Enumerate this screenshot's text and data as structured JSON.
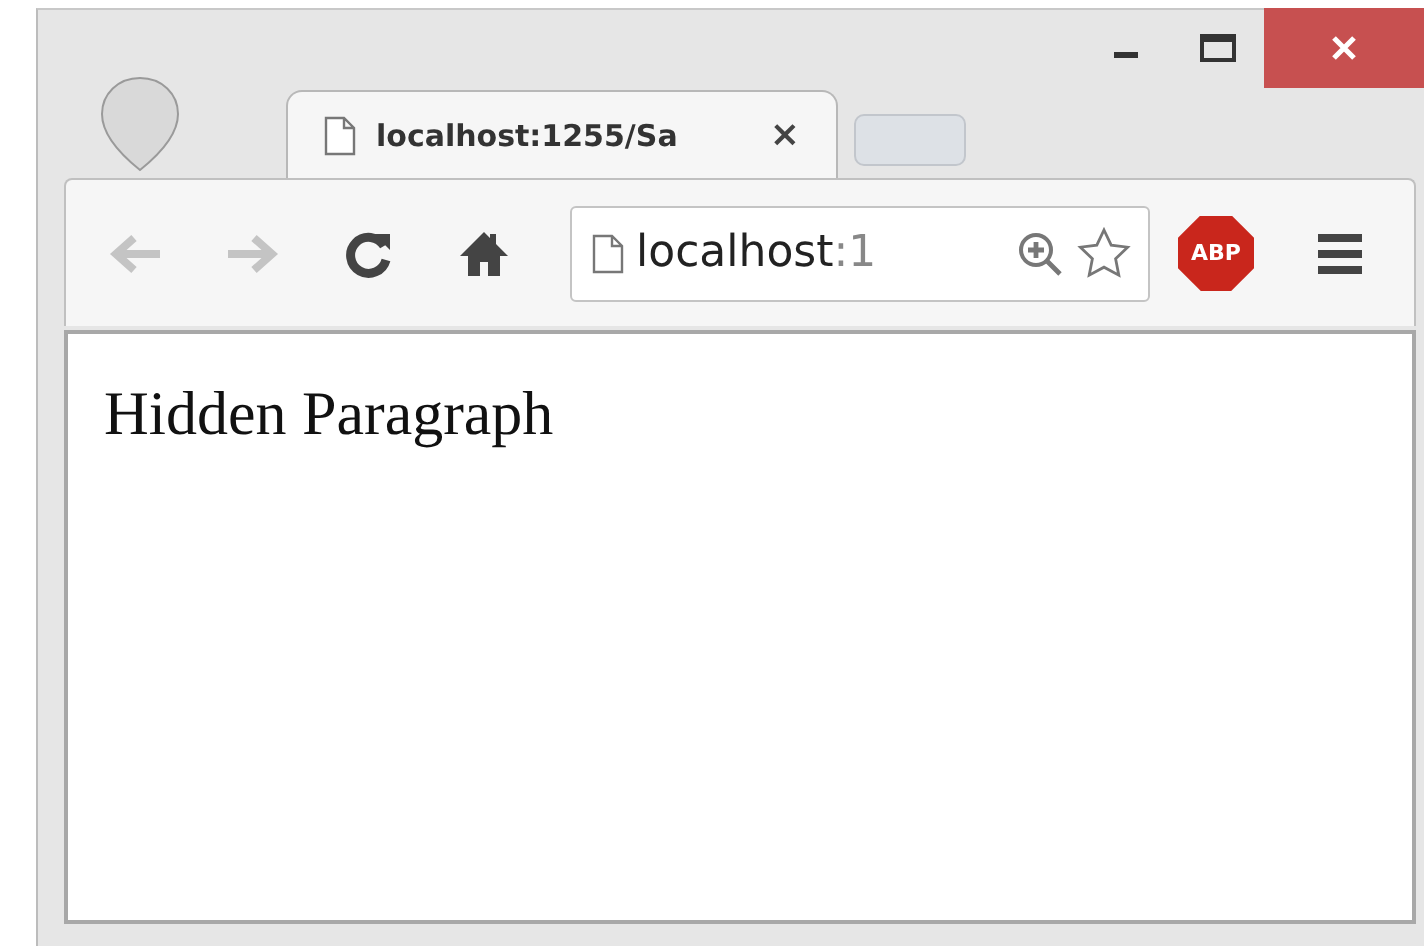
{
  "tab": {
    "title": "localhost:1255/Sa",
    "close": "×"
  },
  "toolbar": {
    "url_host": "localhost",
    "url_rest": ":1",
    "extension_badge": "ABP"
  },
  "page": {
    "text": "Hidden Paragraph"
  }
}
